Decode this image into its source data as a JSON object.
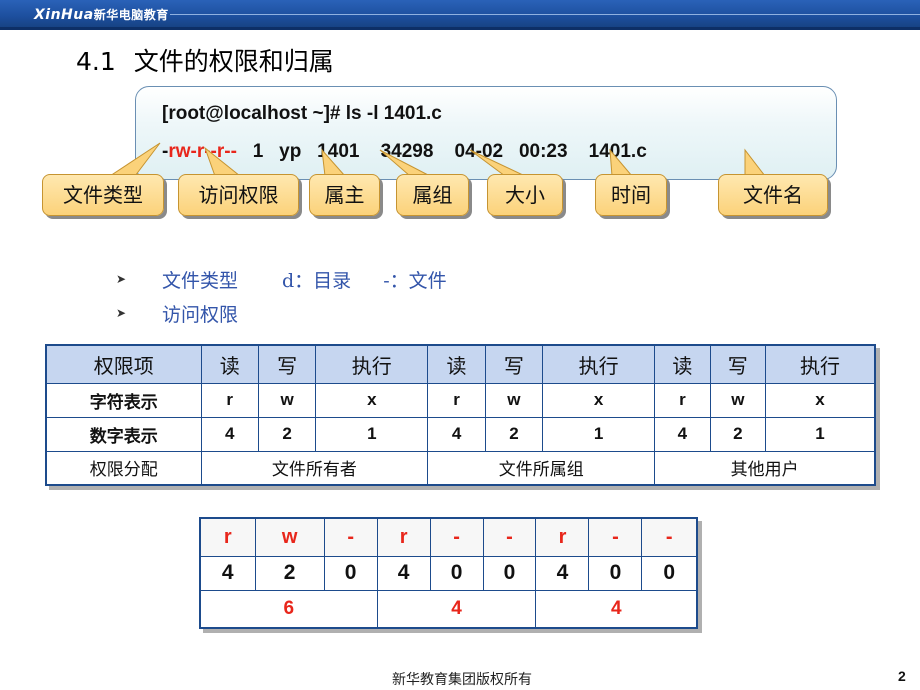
{
  "header": {
    "logo_latin": "XinHua",
    "logo_cn": "新华电脑教育"
  },
  "title": {
    "number": "4.1",
    "text": "文件的权限和归属"
  },
  "command": {
    "line1": "[root@localhost ~]# ls -l 1401.c",
    "perm_dash": "-",
    "perm_bits": "rw-r--r--",
    "rest": "   1   yp   1401    34298    04-02   00:23    1401.c"
  },
  "callouts": [
    "文件类型",
    "访问权限",
    "属主",
    "属组",
    "大小",
    "时间",
    "文件名"
  ],
  "bullets": [
    {
      "label": "文件类型",
      "d_part": "d：目录",
      "f_part": "-：文件"
    },
    {
      "label": "访问权限"
    }
  ],
  "perm_table": {
    "header": [
      "权限项",
      "读",
      "写",
      "执行",
      "读",
      "写",
      "执行",
      "读",
      "写",
      "执行"
    ],
    "rows": [
      [
        "字符表示",
        "r",
        "w",
        "x",
        "r",
        "w",
        "x",
        "r",
        "w",
        "x"
      ],
      [
        "数字表示",
        "4",
        "2",
        "1",
        "4",
        "2",
        "1",
        "4",
        "2",
        "1"
      ]
    ],
    "assign_label": "权限分配",
    "groups": [
      "文件所有者",
      "文件所属组",
      "其他用户"
    ]
  },
  "bits_table": {
    "chars": [
      "r",
      "w",
      "-",
      "r",
      "-",
      "-",
      "r",
      "-",
      "-"
    ],
    "digits": [
      "4",
      "2",
      "0",
      "4",
      "0",
      "0",
      "4",
      "0",
      "0"
    ],
    "sums": [
      "6",
      "4",
      "4"
    ]
  },
  "footer": {
    "text": "新华教育集团版权所有",
    "page": "2"
  }
}
